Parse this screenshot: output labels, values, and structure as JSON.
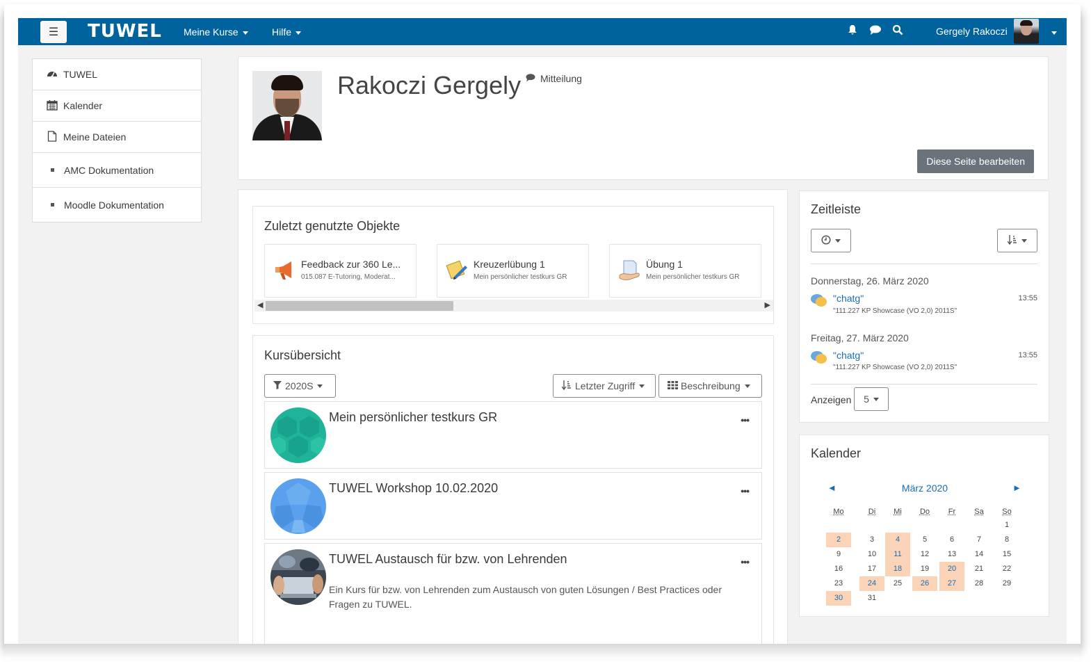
{
  "topbar": {
    "menu_icon": "hamburger-icon",
    "logo": "TUWEL",
    "nav": [
      {
        "label": "Meine Kurse"
      },
      {
        "label": "Hilfe"
      }
    ],
    "icons": [
      "bell-icon",
      "chat-icon",
      "search-icon"
    ],
    "user_name": "Gergely Rakoczi",
    "accent": "#00639e"
  },
  "sidebar": {
    "items": [
      {
        "label": "TUWEL",
        "icon": "dashboard-icon"
      },
      {
        "label": "Kalender",
        "icon": "calendar-icon"
      },
      {
        "label": "Meine Dateien",
        "icon": "file-icon"
      },
      {
        "label": "AMC Dokumentation",
        "icon": "bullet-icon"
      },
      {
        "label": "Moodle Dokumentation",
        "icon": "bullet-icon"
      }
    ]
  },
  "profile": {
    "name": "Rakoczi Gergely",
    "message_label": "Mitteilung",
    "edit_button": "Diese Seite bearbeiten"
  },
  "recent": {
    "title": "Zuletzt genutzte Objekte",
    "items": [
      {
        "title": "Feedback zur 360 Le...",
        "subtitle": "015.087 E-Tutoring, Moderat...",
        "icon": "megaphone-icon"
      },
      {
        "title": "Kreuzerlübung 1",
        "subtitle": "Mein persönlicher testkurs GR",
        "icon": "quiz-pencil-icon"
      },
      {
        "title": "Übung 1",
        "subtitle": "Mein persönlicher testkurs GR",
        "icon": "assignment-hand-icon"
      }
    ]
  },
  "courses": {
    "title": "Kursübersicht",
    "filter": "2020S",
    "sort": "Letzter Zugriff",
    "view": "Beschreibung",
    "items": [
      {
        "name": "Mein persönlicher testkurs GR",
        "description": ""
      },
      {
        "name": "TUWEL Workshop 10.02.2020",
        "description": ""
      },
      {
        "name": "TUWEL Austausch für bzw. von Lehrenden",
        "description": "Ein Kurs für bzw. von Lehrenden zum Austausch von guten Lösungen / Best Practices oder Fragen zu TUWEL."
      }
    ],
    "menu_label": "•••"
  },
  "timeline": {
    "title": "Zeitleiste",
    "days": [
      {
        "day": "Donnerstag, 26. März 2020",
        "event": "\"chatg\"",
        "course": "\"111.227 KP Showcase (VO 2,0) 2011S\"",
        "time": "13:55"
      },
      {
        "day": "Freitag, 27. März 2020",
        "event": "\"chatg\"",
        "course": "\"111.227 KP Showcase (VO 2,0) 2011S\"",
        "time": "13:55"
      }
    ],
    "show_label": "Anzeigen",
    "show_value": "5"
  },
  "calendar": {
    "title": "Kalender",
    "month": "März 2020",
    "prev": "◄",
    "next": "►",
    "weekdays": [
      "Mo",
      "Di",
      "Mi",
      "Do",
      "Fr",
      "Sa",
      "So"
    ],
    "weeks": [
      [
        "",
        "",
        "",
        "",
        "",
        "",
        "1"
      ],
      [
        "2",
        "3",
        "4",
        "5",
        "6",
        "7",
        "8"
      ],
      [
        "9",
        "10",
        "11",
        "12",
        "13",
        "14",
        "15"
      ],
      [
        "16",
        "17",
        "18",
        "19",
        "20",
        "21",
        "22"
      ],
      [
        "23",
        "24",
        "25",
        "26",
        "27",
        "28",
        "29"
      ],
      [
        "30",
        "31",
        "",
        "",
        "",
        "",
        ""
      ]
    ],
    "event_days": [
      "2",
      "4",
      "11",
      "18",
      "20",
      "24",
      "26",
      "27",
      "30"
    ],
    "event_color": "#fbd3b6"
  }
}
